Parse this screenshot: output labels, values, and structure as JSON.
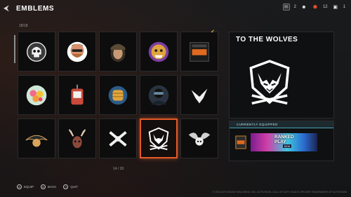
{
  "header": {
    "back_glyph": "⮜",
    "title": "EMBLEMS",
    "status": {
      "messages_count": "2",
      "notif_count": "1",
      "rank_count": "12"
    }
  },
  "grid": {
    "count_label": "18/18",
    "page_label": "14 / 20",
    "tiles": [
      {
        "name": "tile-skull-emblem",
        "icon": "skull-icon",
        "selected": false,
        "checked": false
      },
      {
        "name": "tile-bearded-man-emblem",
        "icon": "portrait-icon",
        "selected": false,
        "checked": false
      },
      {
        "name": "tile-soldier-portrait-emblem",
        "icon": "soldier-icon",
        "selected": false,
        "checked": false
      },
      {
        "name": "tile-beast-emblem",
        "icon": "beast-icon",
        "selected": false,
        "checked": false
      },
      {
        "name": "tile-black-ops-emblem",
        "icon": "black-ops-icon",
        "selected": false,
        "checked": true
      },
      {
        "name": "tile-flowers-emblem",
        "icon": "flower-icon",
        "selected": false,
        "checked": false
      },
      {
        "name": "tile-dogtag-emblem",
        "icon": "dogtag-icon",
        "selected": false,
        "checked": false
      },
      {
        "name": "tile-fist-emblem",
        "icon": "fist-icon",
        "selected": false,
        "checked": false
      },
      {
        "name": "tile-operator-emblem",
        "icon": "operator-icon",
        "selected": false,
        "checked": false
      },
      {
        "name": "tile-bird-emblem",
        "icon": "bird-icon",
        "selected": false,
        "checked": false
      },
      {
        "name": "tile-eagle-emblem",
        "icon": "eagle-icon",
        "selected": false,
        "checked": false
      },
      {
        "name": "tile-deer-emblem",
        "icon": "deer-icon",
        "selected": false,
        "checked": false
      },
      {
        "name": "tile-crossed-guns-emblem",
        "icon": "crossed-guns-icon",
        "selected": false,
        "checked": false
      },
      {
        "name": "tile-wolves-emblem",
        "icon": "wolf-icon",
        "selected": true,
        "checked": false
      },
      {
        "name": "tile-winged-skull-emblem",
        "icon": "winged-skull-icon",
        "selected": false,
        "checked": false
      }
    ]
  },
  "detail": {
    "title": "TO THE WOLVES",
    "icon": "wolf-icon"
  },
  "equipped": {
    "header": "CURRENTLY EQUIPPED",
    "card_text_line1": "RANKED",
    "card_text_line2": "PLAY",
    "card_sub": "BO6"
  },
  "footer": {
    "equip": "EQUIP",
    "back": "BACK",
    "quit": "QUIT",
    "legal": "© 2024 ACTIVISION PUBLISHING, INC. ACTIVISION, CALL OF DUTY, BLACK OPS ARE TRADEMARKS OF ACTIVISION"
  },
  "colors": {
    "accent": "#e45a2a",
    "equipped_header": "#4aa3b8"
  }
}
